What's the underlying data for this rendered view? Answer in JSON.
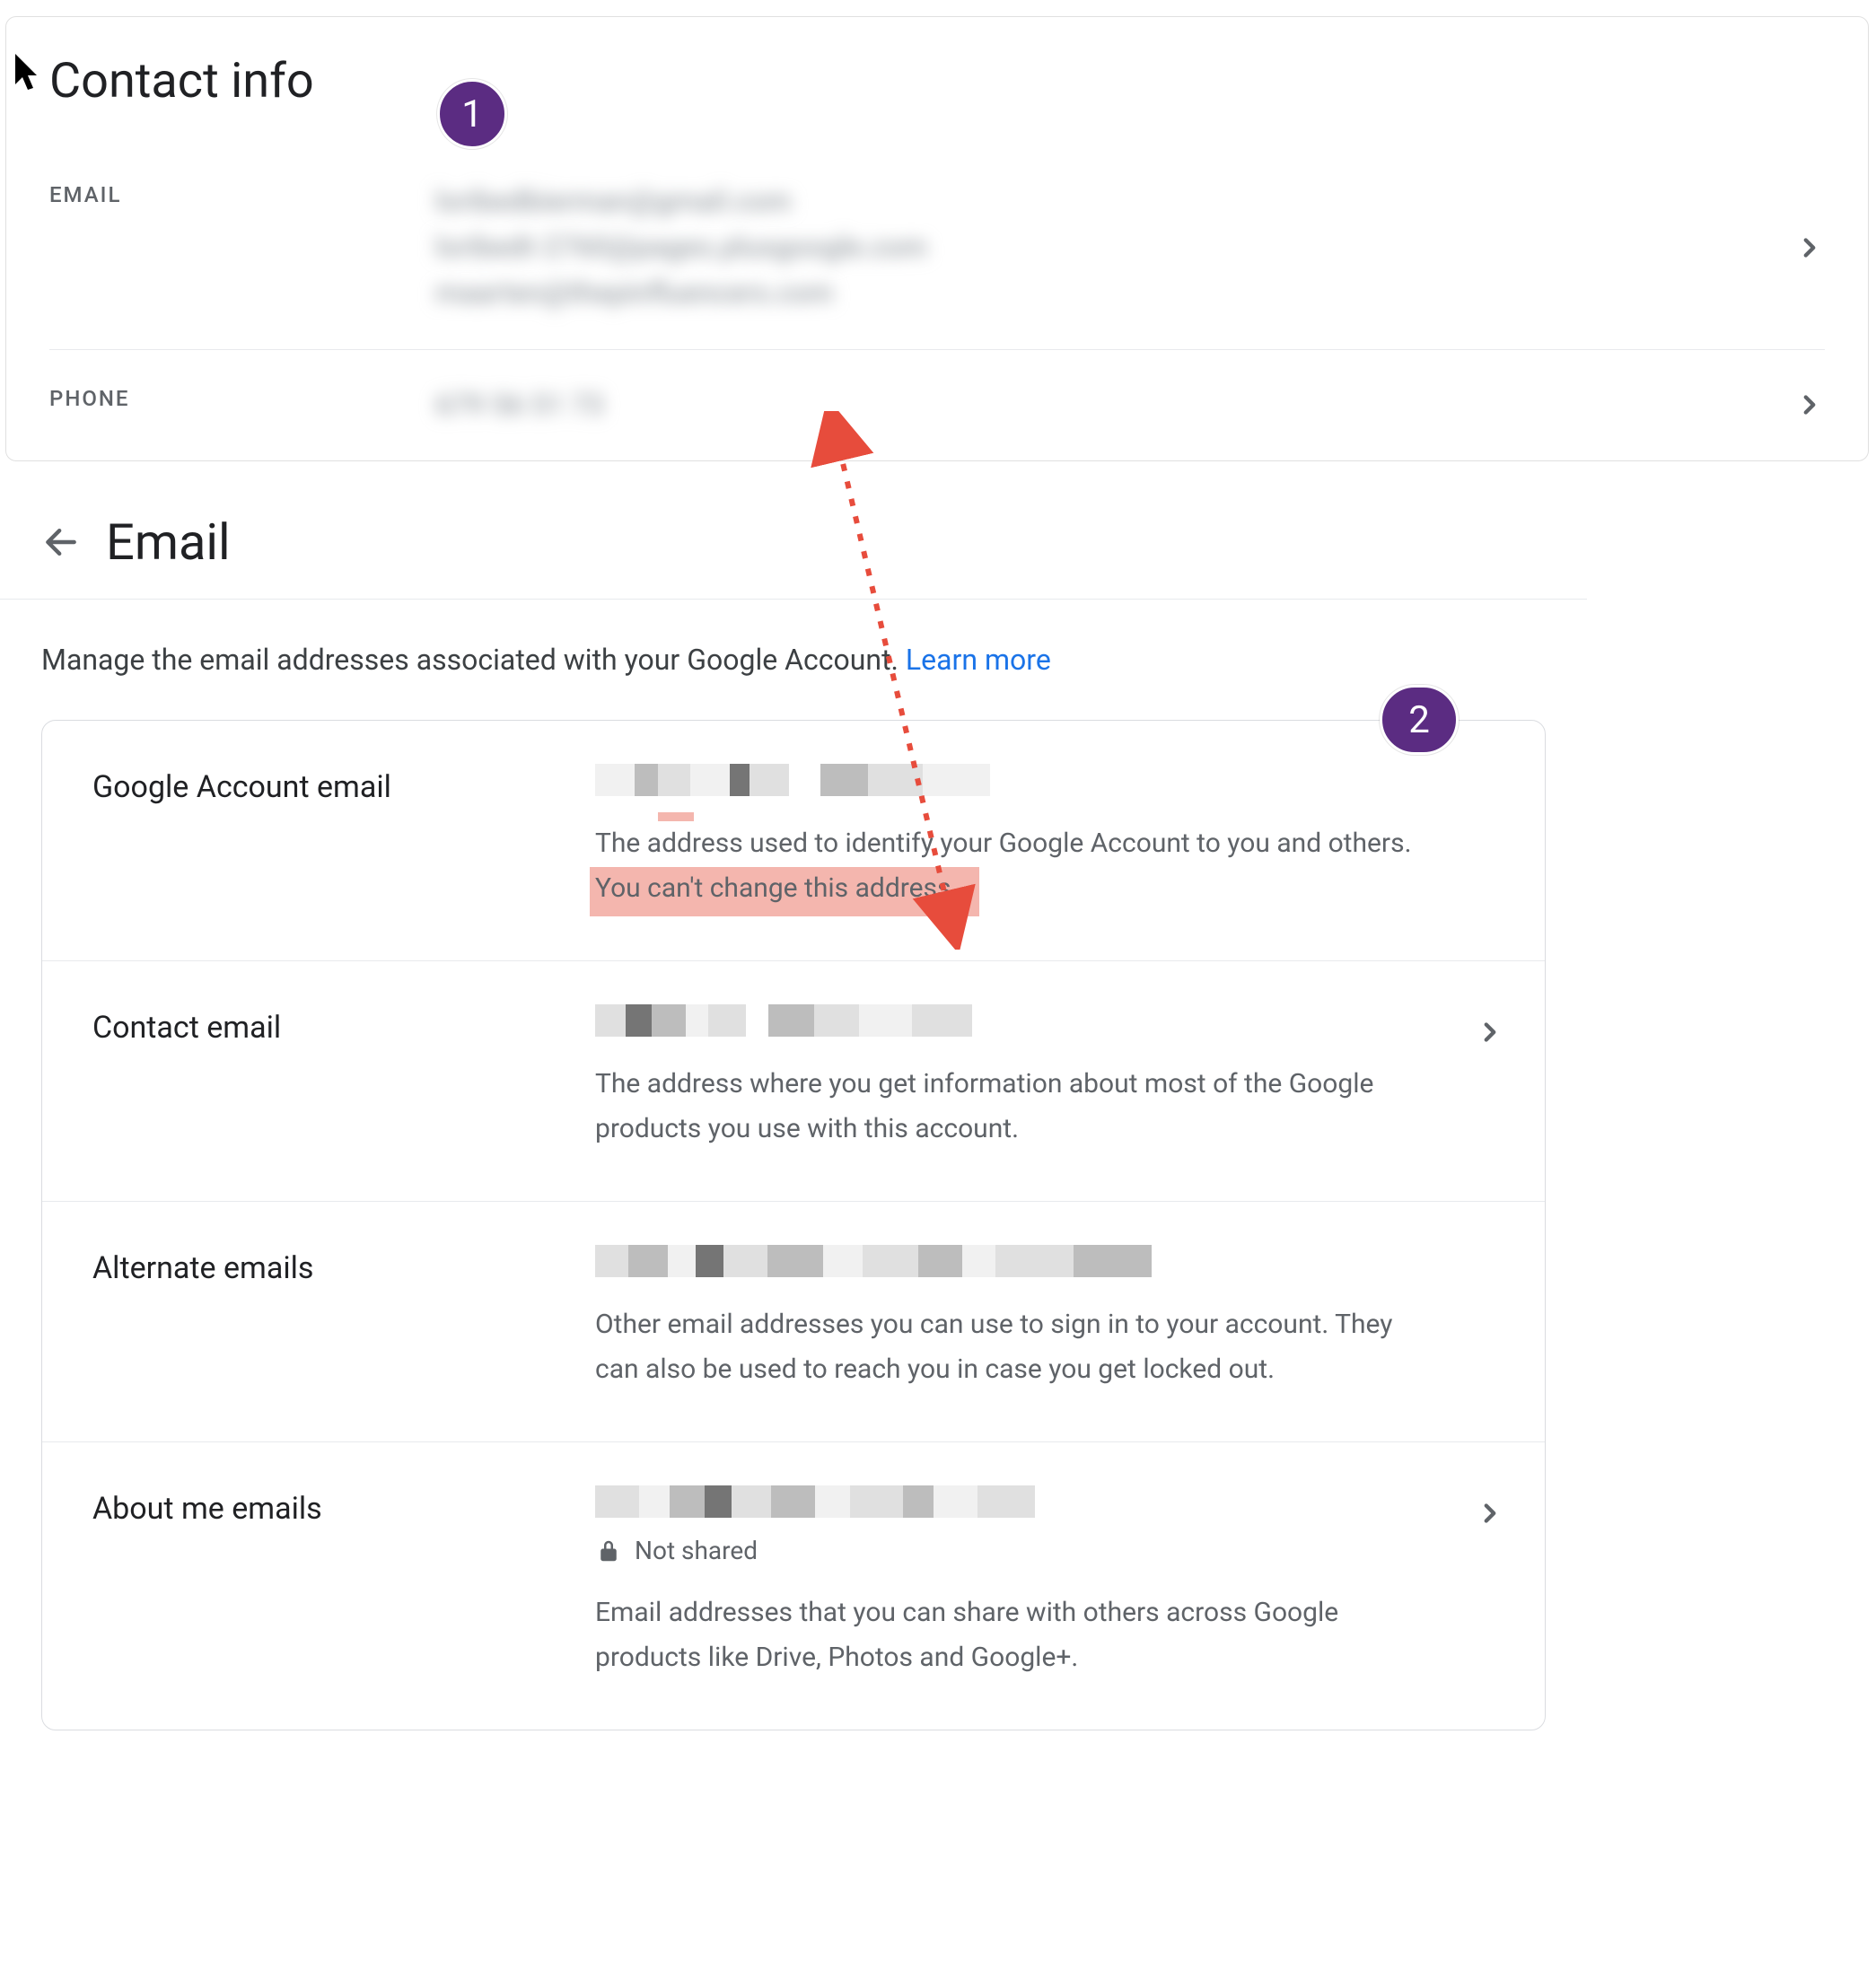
{
  "badges": {
    "one": "1",
    "two": "2"
  },
  "contact": {
    "title": "Contact info",
    "email_label": "EMAIL",
    "phone_label": "PHONE",
    "emails": [
      "loribedbierman@gmail.com",
      "loribedt-2760@pages.plusgoogle.com",
      "maarten@thepinfluencers.com"
    ],
    "phone": "679 56 51 73"
  },
  "email_page": {
    "title": "Email",
    "intro_prefix": "Manage the email addresses associated with your Google Account. ",
    "learn_more": "Learn more",
    "rows": {
      "account": {
        "label": "Google Account email",
        "desc_pre": "The address used to identify your Google Account to you and others. ",
        "desc_hl": "You can't change this address."
      },
      "contact": {
        "label": "Contact email",
        "desc": "The address where you get information about most of the Google products you use with this account."
      },
      "alternate": {
        "label": "Alternate emails",
        "desc": "Other email addresses you can use to sign in to your account. They can also be used to reach you in case you get locked out."
      },
      "about": {
        "label": "About me emails",
        "not_shared": "Not shared",
        "desc": "Email addresses that you can share with others across Google products like Drive, Photos and Google+."
      }
    }
  }
}
